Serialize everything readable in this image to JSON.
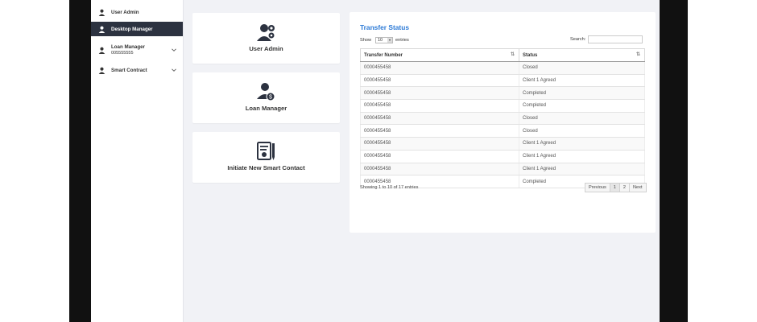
{
  "sidebar": {
    "items": [
      {
        "label": "User Admin",
        "icon": "user-icon"
      },
      {
        "label": "Desktop Manager",
        "icon": "user-icon",
        "active": true
      },
      {
        "label": "Loan Manager",
        "sub": "005555555",
        "icon": "user-icon"
      },
      {
        "label": "Smart Contract",
        "icon": "user-icon"
      }
    ]
  },
  "cards": [
    {
      "label": "User Admin",
      "icon": "user-gear-icon"
    },
    {
      "label": "Loan Manager",
      "icon": "user-dollar-icon"
    },
    {
      "label": "Initiate New Smart Contact",
      "icon": "contract-pen-icon"
    }
  ],
  "transfer": {
    "title": "Transfer Status",
    "show_label": "Show",
    "entries_value": "10",
    "entries_label": "entries",
    "search_label": "Search:",
    "columns": [
      "Transfer Number",
      "Status"
    ],
    "rows": [
      [
        "0000455458",
        "Closed"
      ],
      [
        "0000455458",
        "Client 1 Agreed"
      ],
      [
        "0000455458",
        "Completed"
      ],
      [
        "0000455458",
        "Completed"
      ],
      [
        "0000455458",
        "Closed"
      ],
      [
        "0000455458",
        "Closed"
      ],
      [
        "0000455458",
        "Client 1 Agreed"
      ],
      [
        "0000455458",
        "Client 1 Agreed"
      ],
      [
        "0000455458",
        "Client 1 Agreed"
      ],
      [
        "0000455458",
        "Completed"
      ]
    ],
    "info": "Showing 1 to 10 of 17 entries",
    "pager": {
      "previous": "Previous",
      "page1": "1",
      "page2": "2",
      "next": "Next"
    }
  },
  "colors": {
    "accent": "#2c7ad6",
    "sidebar_active": "#2c3240",
    "background": "#f1f2f6"
  }
}
